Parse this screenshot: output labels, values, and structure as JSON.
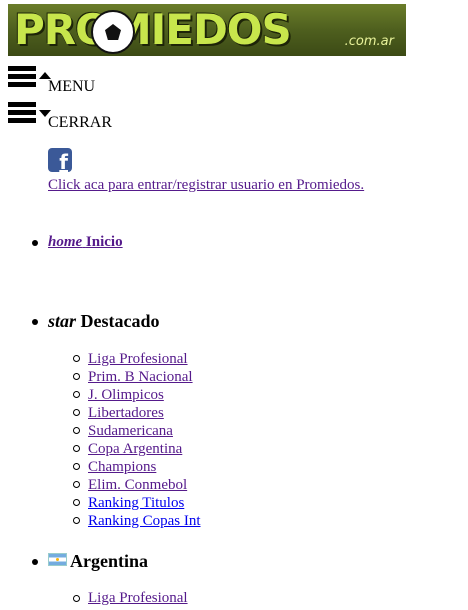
{
  "header": {
    "logo_text": "PROMIEDOS",
    "logo_domain": ".com.ar"
  },
  "menu": {
    "open_label": "MENU",
    "close_label": "CERRAR"
  },
  "facebook": {
    "icon_glyph": "f",
    "link_text": "Click aca para entrar/registrar usuario en Promiedos."
  },
  "nav": {
    "home": {
      "icon_text": "home",
      "label": "Inicio"
    },
    "destacado": {
      "icon_text": "star",
      "label": "Destacado",
      "items": [
        "Liga Profesional",
        "Prim. B Nacional",
        "J. Olimpicos",
        "Libertadores",
        "Sudamericana",
        "Copa Argentina",
        "Champions",
        "Elim. Conmebol",
        "Ranking Titulos",
        "Ranking Copas Int"
      ]
    },
    "argentina": {
      "label": "Argentina",
      "items": [
        "Liga Profesional"
      ]
    }
  },
  "colors": {
    "link_visited": "#551a8b",
    "link": "#0000ee",
    "logo_green": "#c8e64c",
    "facebook_blue": "#3b5998"
  }
}
